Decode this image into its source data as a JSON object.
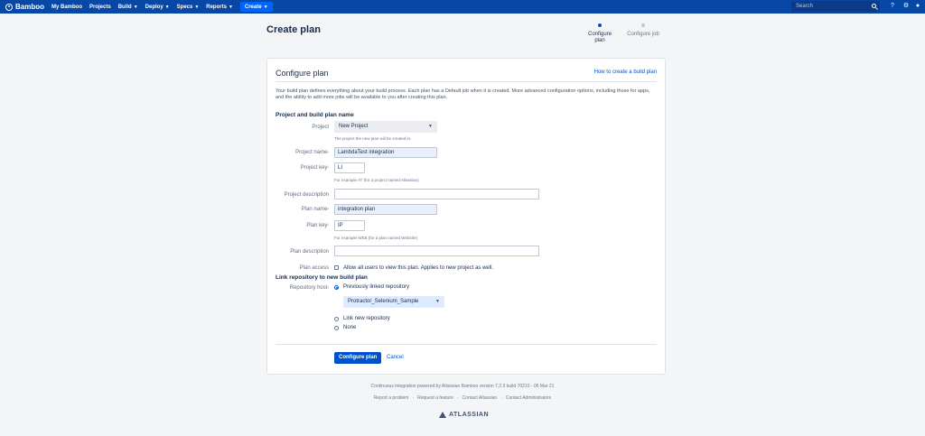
{
  "nav": {
    "brand": "Bamboo",
    "items": [
      {
        "label": "My Bamboo",
        "has_menu": false
      },
      {
        "label": "Projects",
        "has_menu": false
      },
      {
        "label": "Build",
        "has_menu": true
      },
      {
        "label": "Deploy",
        "has_menu": true
      },
      {
        "label": "Specs",
        "has_menu": true
      },
      {
        "label": "Reports",
        "has_menu": true
      }
    ],
    "create_label": "Create",
    "search_placeholder": "Search"
  },
  "page": {
    "title": "Create plan",
    "steps": [
      {
        "label": "Configure plan",
        "state": "active"
      },
      {
        "label": "Configure job",
        "state": "todo"
      }
    ]
  },
  "panel": {
    "title": "Configure plan",
    "help_link": "How to create a build plan",
    "intro": "Your build plan defines everything about your build process. Each plan has a Default job when it is created. More advanced configuration options, including those for apps, and the ability to add more jobs will be available to you after creating this plan.",
    "section_project": "Project and build plan name",
    "project": {
      "label": "Project",
      "value": "New Project",
      "hint": "The project the new plan will be created in."
    },
    "project_name": {
      "label": "Project name",
      "value": "LambdaTest integration"
    },
    "project_key": {
      "label": "Project key",
      "value": "LI",
      "hint": "For example AT (for a project named Atlassian)"
    },
    "project_description": {
      "label": "Project description",
      "value": ""
    },
    "plan_name": {
      "label": "Plan name",
      "value": "integration plan"
    },
    "plan_key": {
      "label": "Plan key",
      "value": "IP",
      "hint": "For example WEB (for a plan named Website)"
    },
    "plan_description": {
      "label": "Plan description",
      "value": ""
    },
    "plan_access": {
      "label": "Plan access",
      "checkbox_label": "Allow all users to view this plan. Applies to new project as well.",
      "checked": false
    },
    "section_repo": "Link repository to new build plan",
    "repository_host": {
      "label": "Repository host",
      "options": [
        {
          "label": "Previously linked repository",
          "selected": true
        },
        {
          "label": "Link new repository",
          "selected": false
        },
        {
          "label": "None",
          "selected": false
        }
      ],
      "linked_repo": "Protractor_Selenium_Sample"
    },
    "submit_label": "Configure plan",
    "cancel_label": "Cancel"
  },
  "footer": {
    "powered_by": "Continuous integration powered by Atlassian Bamboo version 7.2.3 build 70210 - 06 Mar 21",
    "links": [
      "Report a problem",
      "Request a feature",
      "Contact Atlassian",
      "Contact Administrators"
    ],
    "logo_text": "ATLASSIAN"
  }
}
